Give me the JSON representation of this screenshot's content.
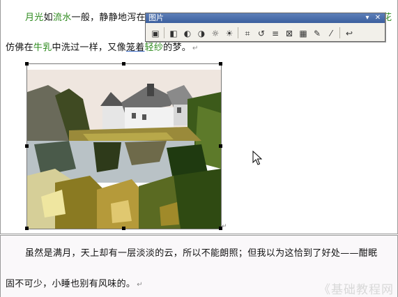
{
  "document": {
    "line1": {
      "s1": "月光",
      "s2": "如",
      "s3": "流水",
      "s4": "一般，静静地泻在"
    },
    "line1_right": "花",
    "line2": {
      "s1": "仿佛在",
      "s2": "牛乳",
      "s3": "中洗过一样，又像",
      "s4": "笼着",
      "s5": "轻纱",
      "s6": "的梦。"
    },
    "line3": "虽然是满月，天上却有一层淡淡的云，所以不能朗照；但我以为这恰到了好处——酣眠",
    "line4": "固不可少，小睡也别有风味的。",
    "para_mark": "↵"
  },
  "toolbar": {
    "title": "图片",
    "menu_glyph": "▾",
    "close_glyph": "✕",
    "buttons": [
      {
        "name": "insert-picture-icon",
        "glyph": "▣"
      },
      {
        "name": "color-icon",
        "glyph": "◧"
      },
      {
        "name": "more-contrast-icon",
        "glyph": "◐"
      },
      {
        "name": "less-contrast-icon",
        "glyph": "◑"
      },
      {
        "name": "more-brightness-icon",
        "glyph": "☼"
      },
      {
        "name": "less-brightness-icon",
        "glyph": "☀"
      },
      {
        "name": "crop-icon",
        "glyph": "⌗"
      },
      {
        "name": "rotate-left-icon",
        "glyph": "↺"
      },
      {
        "name": "line-style-icon",
        "glyph": "≡"
      },
      {
        "name": "compress-picture-icon",
        "glyph": "⊠"
      },
      {
        "name": "text-wrapping-icon",
        "glyph": "▦"
      },
      {
        "name": "format-picture-icon",
        "glyph": "✎"
      },
      {
        "name": "set-transparent-color-icon",
        "glyph": "⁄"
      },
      {
        "name": "reset-picture-icon",
        "glyph": "↩"
      }
    ]
  },
  "watermark": "《基础教程网"
}
